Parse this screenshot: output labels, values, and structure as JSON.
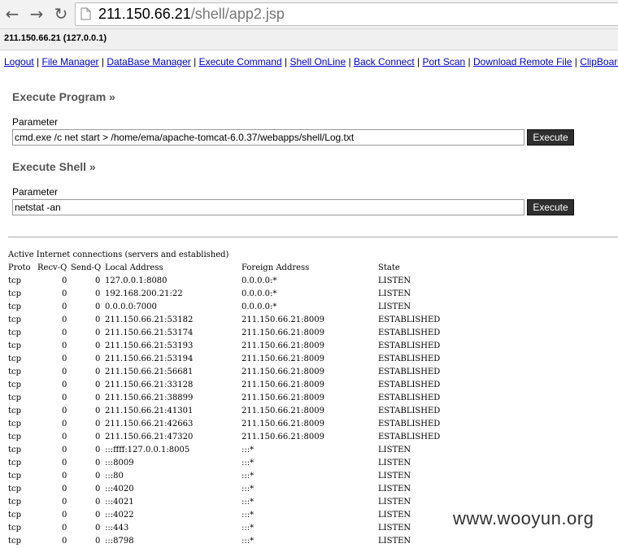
{
  "browser": {
    "url_host": "211.150.66.21",
    "url_path": "/shell/app2.jsp"
  },
  "host_info": "211.150.66.21 (127.0.0.1)",
  "menu": [
    "Logout",
    "File Manager",
    "DataBase Manager",
    "Execute Command",
    "Shell OnLine",
    "Back Connect",
    "Port Scan",
    "Download Remote File",
    "ClipBoard"
  ],
  "menu_separator": "|",
  "execute_program": {
    "title": "Execute Program »",
    "param_label": "Parameter",
    "param_value": "cmd.exe /c net start > /home/ema/apache-tomcat-6.0.37/webapps/shell/Log.txt",
    "button": "Execute"
  },
  "execute_shell": {
    "title": "Execute Shell »",
    "param_label": "Parameter",
    "param_value": "netstat -an",
    "button": "Execute"
  },
  "output": {
    "header_line": "Active Internet connections (servers and established)",
    "columns": [
      "Proto",
      "Recv-Q",
      "Send-Q",
      "Local Address",
      "Foreign Address",
      "State"
    ],
    "rows": [
      [
        "tcp",
        "0",
        "0",
        "127.0.0.1:8080",
        "0.0.0.0:*",
        "LISTEN"
      ],
      [
        "tcp",
        "0",
        "0",
        "192.168.200.21:22",
        "0.0.0.0:*",
        "LISTEN"
      ],
      [
        "tcp",
        "0",
        "0",
        "0.0.0.0:7000",
        "0.0.0.0:*",
        "LISTEN"
      ],
      [
        "tcp",
        "0",
        "0",
        "211.150.66.21:53182",
        "211.150.66.21:8009",
        "ESTABLISHED"
      ],
      [
        "tcp",
        "0",
        "0",
        "211.150.66.21:53174",
        "211.150.66.21:8009",
        "ESTABLISHED"
      ],
      [
        "tcp",
        "0",
        "0",
        "211.150.66.21:53193",
        "211.150.66.21:8009",
        "ESTABLISHED"
      ],
      [
        "tcp",
        "0",
        "0",
        "211.150.66.21:53194",
        "211.150.66.21:8009",
        "ESTABLISHED"
      ],
      [
        "tcp",
        "0",
        "0",
        "211.150.66.21:56681",
        "211.150.66.21:8009",
        "ESTABLISHED"
      ],
      [
        "tcp",
        "0",
        "0",
        "211.150.66.21:33128",
        "211.150.66.21:8009",
        "ESTABLISHED"
      ],
      [
        "tcp",
        "0",
        "0",
        "211.150.66.21:38899",
        "211.150.66.21:8009",
        "ESTABLISHED"
      ],
      [
        "tcp",
        "0",
        "0",
        "211.150.66.21:41301",
        "211.150.66.21:8009",
        "ESTABLISHED"
      ],
      [
        "tcp",
        "0",
        "0",
        "211.150.66.21:42663",
        "211.150.66.21:8009",
        "ESTABLISHED"
      ],
      [
        "tcp",
        "0",
        "0",
        "211.150.66.21:47320",
        "211.150.66.21:8009",
        "ESTABLISHED"
      ],
      [
        "tcp",
        "0",
        "0",
        ":::ffff:127.0.0.1:8005",
        ":::*",
        "LISTEN"
      ],
      [
        "tcp",
        "0",
        "0",
        ":::8009",
        ":::*",
        "LISTEN"
      ],
      [
        "tcp",
        "0",
        "0",
        ":::80",
        ":::*",
        "LISTEN"
      ],
      [
        "tcp",
        "0",
        "0",
        ":::4020",
        ":::*",
        "LISTEN"
      ],
      [
        "tcp",
        "0",
        "0",
        ":::4021",
        ":::*",
        "LISTEN"
      ],
      [
        "tcp",
        "0",
        "0",
        ":::4022",
        ":::*",
        "LISTEN"
      ],
      [
        "tcp",
        "0",
        "0",
        ":::443",
        ":::*",
        "LISTEN"
      ],
      [
        "tcp",
        "0",
        "0",
        ":::8798",
        ":::*",
        "LISTEN"
      ]
    ]
  },
  "watermark": "www.wooyun.org"
}
